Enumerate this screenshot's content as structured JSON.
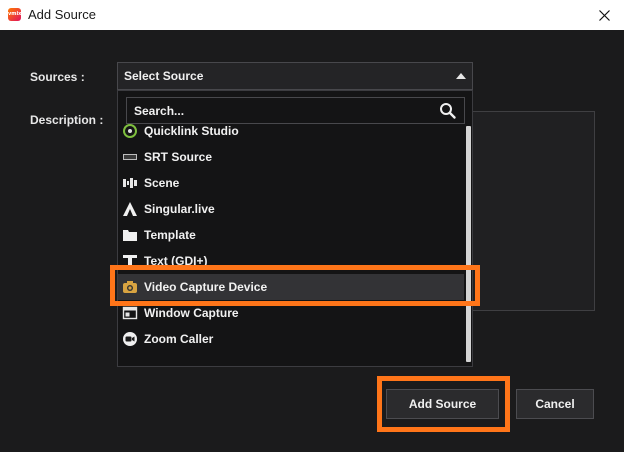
{
  "window": {
    "title": "Add Source",
    "logo_text": "vmix"
  },
  "form": {
    "sources_label": "Sources :",
    "description_label": "Description :",
    "selected_value": "Select Source"
  },
  "dropdown": {
    "search_placeholder": "Search...",
    "items": [
      {
        "label": "Quicklink Studio",
        "icon": "quicklink-icon"
      },
      {
        "label": "SRT Source",
        "icon": "srt-icon"
      },
      {
        "label": "Scene",
        "icon": "scene-icon"
      },
      {
        "label": "Singular.live",
        "icon": "singular-icon"
      },
      {
        "label": "Template",
        "icon": "template-icon"
      },
      {
        "label": "Text (GDI+)",
        "icon": "text-icon"
      },
      {
        "label": "Video Capture Device",
        "icon": "camera-icon"
      },
      {
        "label": "Window Capture",
        "icon": "window-icon"
      },
      {
        "label": "Zoom Caller",
        "icon": "zoom-icon"
      }
    ],
    "selected_index": 6
  },
  "buttons": {
    "add_source": "Add Source",
    "cancel": "Cancel"
  },
  "colors": {
    "highlight": "#ff7519",
    "background": "#1b1b1c"
  }
}
